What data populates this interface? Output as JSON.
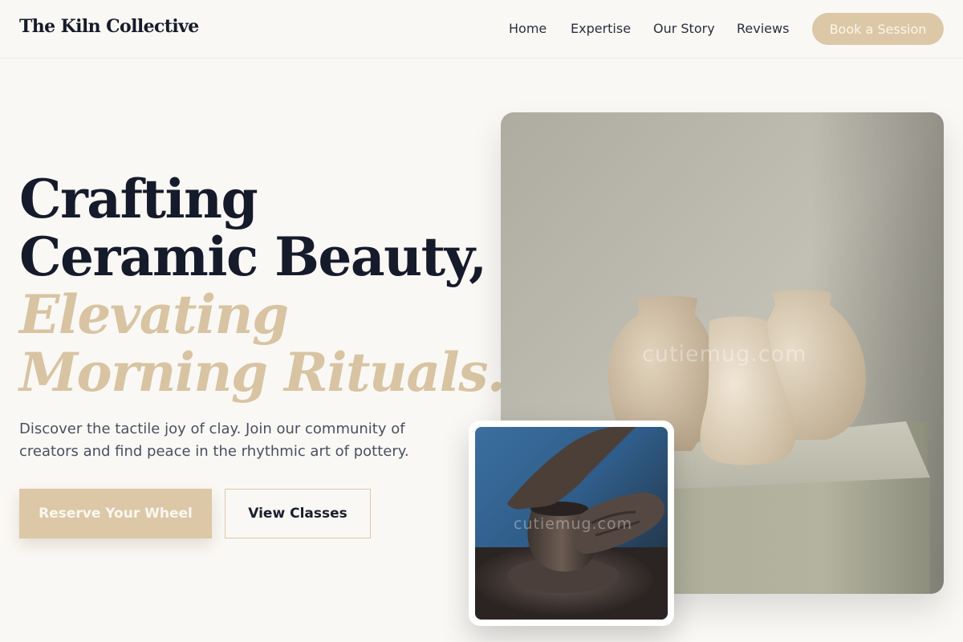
{
  "header": {
    "brand": "The Kiln Collective",
    "nav": [
      "Home",
      "Expertise",
      "Our Story",
      "Reviews"
    ],
    "cta_label": "Book a Session"
  },
  "hero": {
    "headline": {
      "line1": "Crafting",
      "line2": "Ceramic Beauty,",
      "line3": "Elevating",
      "line4": "Morning Rituals."
    },
    "description": "Discover the tactile joy of clay. Join our community of creators and find peace in the rhythmic art of pottery.",
    "primary_button": "Reserve Your Wheel",
    "secondary_button": "View Classes"
  },
  "images": {
    "main_watermark": "cutiemug.com",
    "inset_watermark": "cutiemug.com"
  },
  "colors": {
    "background": "#faf8f5",
    "accent": "#dcc8a6",
    "heading_dark": "#161b2b",
    "heading_gold": "#d8c4a2",
    "body_text": "#4a5060"
  }
}
